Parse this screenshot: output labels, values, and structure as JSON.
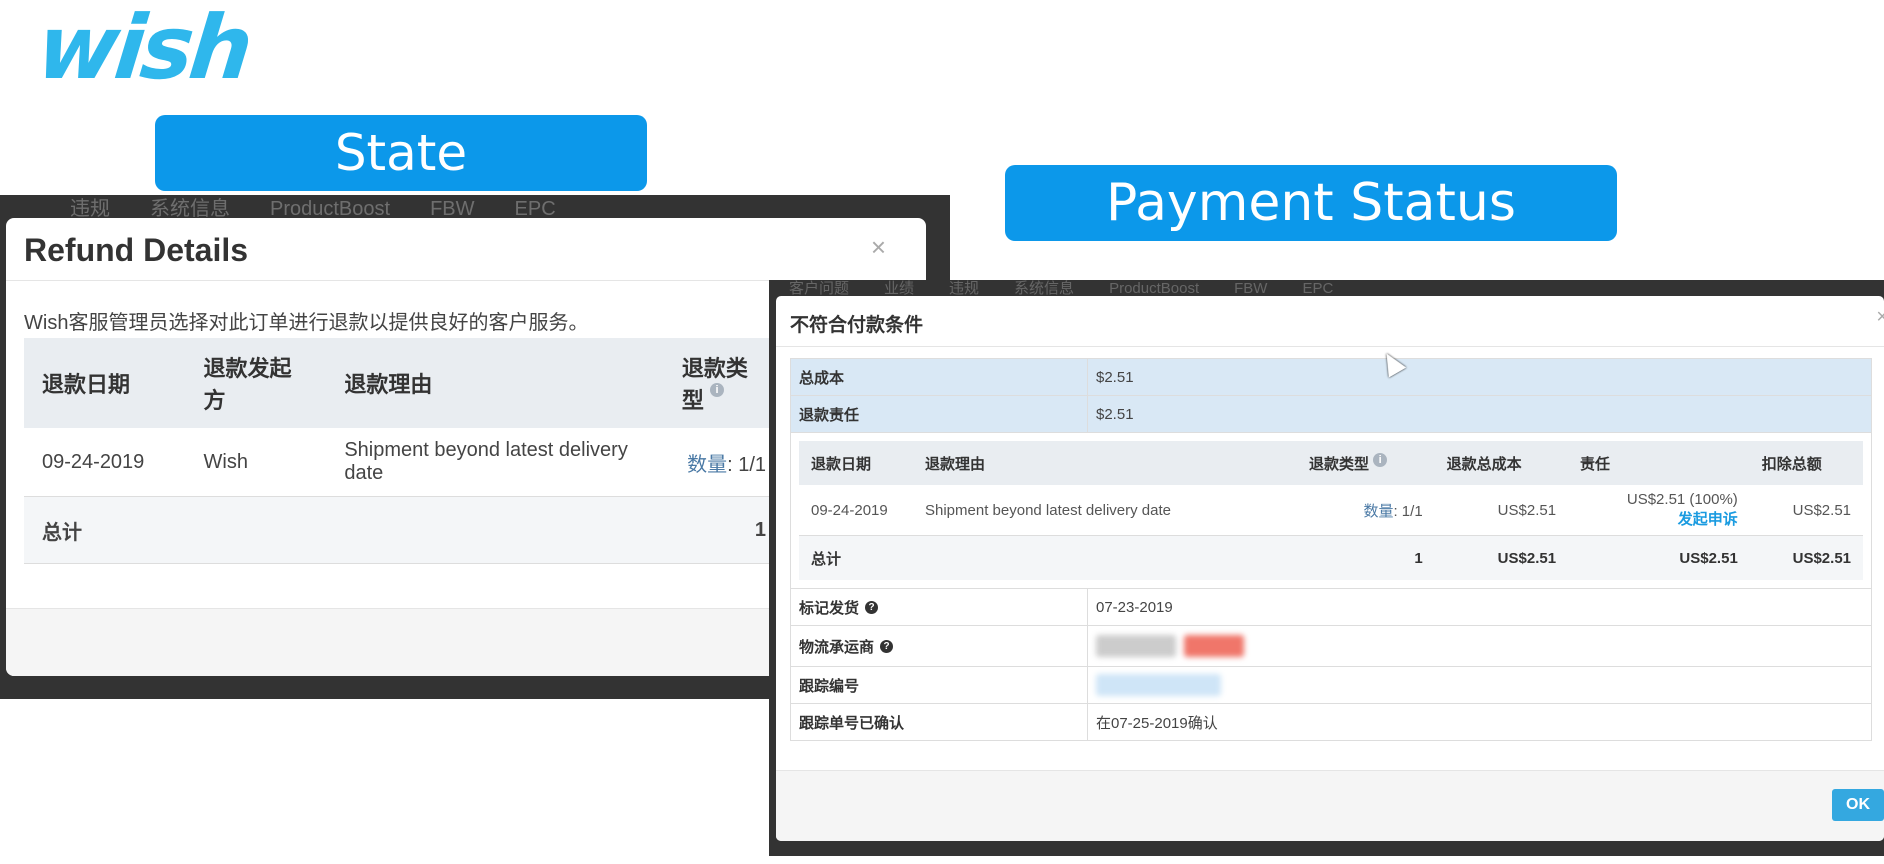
{
  "logo": {
    "text": "wish"
  },
  "labels": {
    "state": "State",
    "payment_status": "Payment Status"
  },
  "left_nav": [
    "违规",
    "系统信息",
    "ProductBoost",
    "FBW",
    "EPC"
  ],
  "refund_modal": {
    "title": "Refund Details",
    "close": "×",
    "description": "Wish客服管理员选择对此订单进行退款以提供良好的客户服务。",
    "headers": {
      "date": "退款日期",
      "initiator": "退款发起方",
      "reason": "退款理由",
      "type": "退款类型"
    },
    "row": {
      "date": "09-24-2019",
      "initiator": "Wish",
      "reason": "Shipment beyond latest delivery date",
      "qty_label": "数量",
      "qty_value": ": 1/1"
    },
    "total_label": "总计",
    "total_value": "1"
  },
  "right_nav": [
    "客户问题",
    "业绩",
    "违规",
    "系统信息",
    "ProductBoost",
    "FBW",
    "EPC"
  ],
  "payment_modal": {
    "title": "不符合付款条件",
    "close": "×",
    "total_cost_label": "总成本",
    "total_cost_value": "$2.51",
    "liability_label": "退款责任",
    "liability_value": "$2.51",
    "table_headers": {
      "date": "退款日期",
      "reason": "退款理由",
      "type": "退款类型",
      "total_cost": "退款总成本",
      "responsibility": "责任",
      "deduction": "扣除总额"
    },
    "row": {
      "date": "09-24-2019",
      "reason": "Shipment beyond latest delivery date",
      "qty_label": "数量",
      "qty_value": ": 1/1",
      "total_cost": "US$2.51",
      "responsibility": "US$2.51 (100%)",
      "appeal": "发起申诉",
      "deduction": "US$2.51"
    },
    "total_row": {
      "label": "总计",
      "qty": "1",
      "total_cost": "US$2.51",
      "responsibility": "US$2.51",
      "deduction": "US$2.51"
    },
    "marked_shipped_label": "标记发货",
    "marked_shipped_value": "07-23-2019",
    "carrier_label": "物流承运商",
    "tracking_label": "跟踪编号",
    "tracking_confirmed_label": "跟踪单号已确认",
    "tracking_confirmed_value": "在07-25-2019确认",
    "ok_button": "OK"
  }
}
